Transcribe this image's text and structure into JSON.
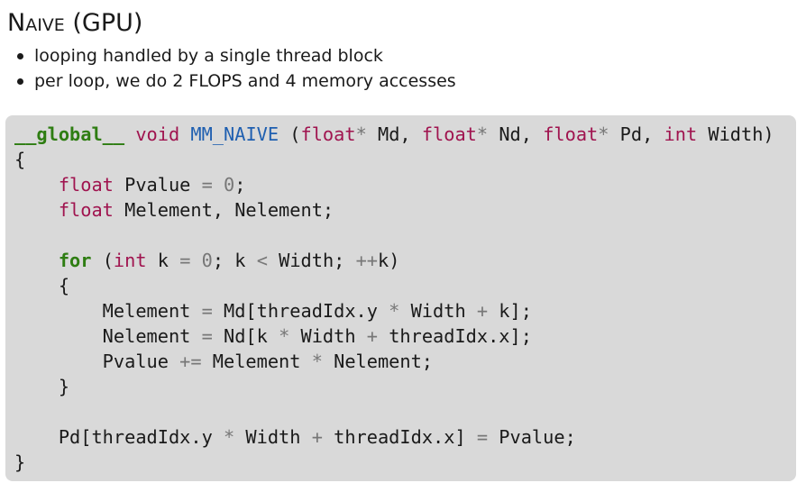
{
  "title": {
    "word_smallcaps": "Naive",
    "suffix": " (GPU)"
  },
  "bullets": [
    "looping handled by a single thread block",
    "per loop, we do 2 FLOPS and 4 memory accesses"
  ],
  "code": {
    "language": "cuda",
    "lines": [
      "__global__ void MM_NAIVE (float* Md, float* Nd, float* Pd, int Width)",
      "{",
      "    float Pvalue = 0;",
      "    float Melement, Nelement;",
      "",
      "    for (int k = 0; k < Width; ++k)",
      "    {",
      "        Melement = Md[threadIdx.y * Width + k];",
      "        Nelement = Nd[k * Width + threadIdx.x];",
      "        Pvalue += Melement * Nelement;",
      "    }",
      "",
      "    Pd[threadIdx.y * Width + threadIdx.x] = Pvalue;",
      "}"
    ]
  },
  "colors": {
    "code_background": "#d9d9d9",
    "keyword_green": "#2e7d12",
    "type_magenta": "#a0144f",
    "function_blue": "#1f5fb0",
    "operator_gray": "#777777"
  }
}
